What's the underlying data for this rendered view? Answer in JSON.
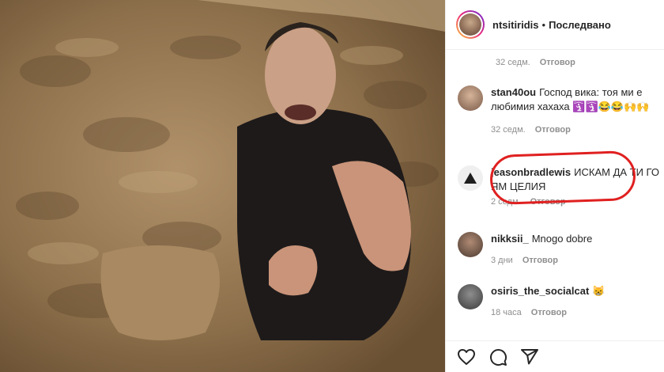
{
  "header": {
    "username": "ntsitiridis",
    "separator": "•",
    "follow_status": "Последвано"
  },
  "top_meta": {
    "time": "32 седм.",
    "reply": "Отговор"
  },
  "comments": [
    {
      "username": "stan40ou",
      "text": "Господ вика: тоя ми е любимия хахаха 🛐🛐😂😂🙌🙌",
      "time": "32 седм.",
      "reply": "Отговор"
    },
    {
      "username": "jeasonbradlewis",
      "text": "ИСКАМ ДА ТИ ГО ЯМ ЦЕЛИЯ",
      "time": "2 седм.",
      "reply": "Отговор"
    },
    {
      "username": "nikksii_",
      "text": "Mnogo dobre",
      "time": "3 дни",
      "reply": "Отговор"
    },
    {
      "username": "osiris_the_socialcat",
      "text": "😸",
      "time": "18 часа",
      "reply": "Отговор"
    }
  ],
  "colors": {
    "highlight": "#e02020",
    "text": "#262626",
    "meta": "#8e8e8e"
  },
  "icons": [
    "heart-icon",
    "comment-icon",
    "share-icon"
  ]
}
